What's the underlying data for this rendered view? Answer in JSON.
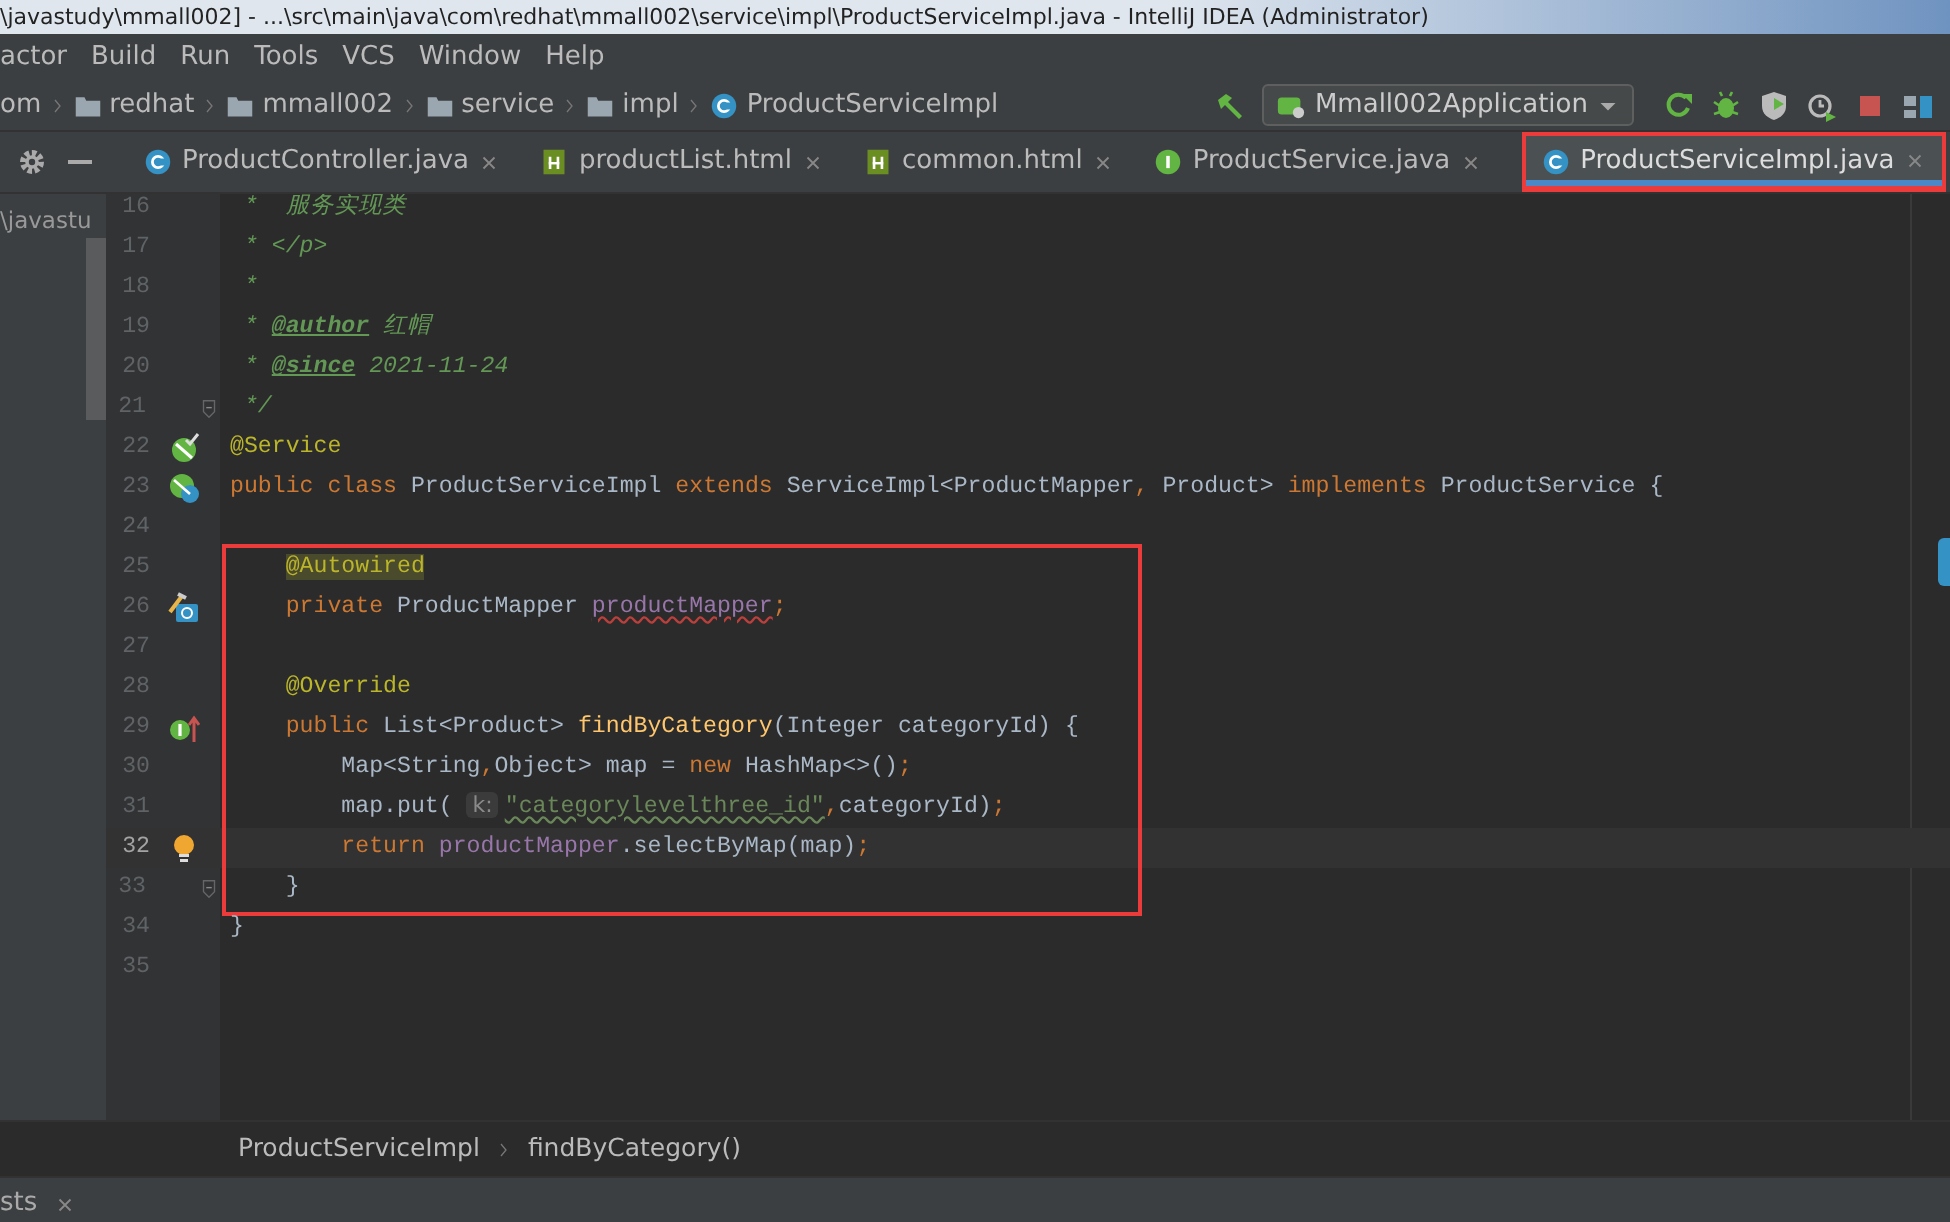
{
  "window": {
    "title": "\\javastudy\\mmall002] - ...\\src\\main\\java\\com\\redhat\\mmall002\\service\\impl\\ProductServiceImpl.java - IntelliJ IDEA (Administrator)"
  },
  "menu": [
    "actor",
    "Build",
    "Run",
    "Tools",
    "VCS",
    "Window",
    "Help"
  ],
  "breadcrumbs": [
    {
      "kind": "text",
      "label": "om"
    },
    {
      "kind": "folder",
      "label": "redhat"
    },
    {
      "kind": "folder",
      "label": "mmall002"
    },
    {
      "kind": "folder",
      "label": "service"
    },
    {
      "kind": "folder",
      "label": "impl"
    },
    {
      "kind": "class",
      "label": "ProductServiceImpl"
    }
  ],
  "run_config": "Mmall002Application",
  "project_panel": {
    "path": "\\javastu"
  },
  "tabs": [
    {
      "label": "ProductController.java",
      "kind": "class",
      "selected": false,
      "highlighted": false
    },
    {
      "label": "productList.html",
      "kind": "html",
      "selected": false,
      "highlighted": false
    },
    {
      "label": "common.html",
      "kind": "html",
      "selected": false,
      "highlighted": false
    },
    {
      "label": "ProductService.java",
      "kind": "interface",
      "selected": false,
      "highlighted": false
    },
    {
      "label": "ProductServiceImpl.java",
      "kind": "class",
      "selected": true,
      "highlighted": true
    }
  ],
  "code": [
    {
      "highlighted": false,
      "lines": [
        {
          "number": "16",
          "current": false,
          "tokens": [
            {
              "kind": "comment",
              "text": " *  服务实现类"
            }
          ]
        },
        {
          "number": "17",
          "current": false,
          "tokens": [
            {
              "kind": "comment",
              "text": " * </p>"
            }
          ]
        },
        {
          "number": "18",
          "current": false,
          "tokens": [
            {
              "kind": "comment",
              "text": " *"
            }
          ]
        },
        {
          "number": "19",
          "current": false,
          "tokens": [
            {
              "kind": "comment",
              "text": " * "
            },
            {
              "kind": "doctag",
              "text": "@author"
            },
            {
              "kind": "comment",
              "text": " 红帽"
            }
          ]
        },
        {
          "number": "20",
          "current": false,
          "tokens": [
            {
              "kind": "comment",
              "text": " * "
            },
            {
              "kind": "doctag",
              "text": "@since"
            },
            {
              "kind": "comment",
              "text": " 2021-11-24"
            }
          ]
        },
        {
          "number": "21",
          "current": false,
          "gutter": {
            "kind": "fold"
          },
          "tokens": [
            {
              "kind": "comment",
              "text": " */"
            }
          ]
        },
        {
          "number": "22",
          "current": false,
          "gutter": {
            "kind": "bean"
          },
          "tokens": [
            {
              "kind": "annotation",
              "text": "@Service"
            }
          ]
        },
        {
          "number": "23",
          "current": false,
          "gutter": {
            "kind": "bean-class"
          },
          "tokens": [
            {
              "kind": "keyword",
              "text": "public class "
            },
            {
              "kind": "plain",
              "text": "ProductServiceImpl "
            },
            {
              "kind": "keyword",
              "text": "extends "
            },
            {
              "kind": "plain",
              "text": "ServiceImpl<ProductMapper"
            },
            {
              "kind": "keyword",
              "text": ","
            },
            {
              "kind": "plain",
              "text": " Product> "
            },
            {
              "kind": "keyword",
              "text": "implements "
            },
            {
              "kind": "plain",
              "text": "ProductService {"
            }
          ]
        },
        {
          "number": "24",
          "current": false
        }
      ]
    },
    {
      "highlighted": true,
      "lines": [
        {
          "number": "25",
          "current": false,
          "tokens": [
            {
              "kind": "annotation-marked",
              "text": "    @Autowired"
            }
          ]
        },
        {
          "number": "26",
          "current": false,
          "gutter": {
            "kind": "autowired"
          },
          "tokens": [
            {
              "kind": "keyword",
              "text": "    private "
            },
            {
              "kind": "plain",
              "text": "ProductMapper "
            },
            {
              "kind": "field-warning",
              "text": "productMapper"
            },
            {
              "kind": "keyword",
              "text": ";"
            }
          ]
        },
        {
          "number": "27",
          "current": false
        },
        {
          "number": "28",
          "current": false,
          "tokens": [
            {
              "kind": "annotation",
              "text": "    @Override"
            }
          ]
        },
        {
          "number": "29",
          "current": false,
          "gutter": {
            "kind": "implements"
          },
          "tokens": [
            {
              "kind": "keyword",
              "text": "    public "
            },
            {
              "kind": "plain",
              "text": "List<Product> "
            },
            {
              "kind": "method",
              "text": "findByCategory"
            },
            {
              "kind": "plain",
              "text": "(Integer categoryId) {"
            }
          ]
        },
        {
          "number": "30",
          "current": false,
          "tokens": [
            {
              "kind": "plain",
              "text": "        Map<String"
            },
            {
              "kind": "keyword",
              "text": ","
            },
            {
              "kind": "plain",
              "text": "Object> map = "
            },
            {
              "kind": "keyword",
              "text": "new "
            },
            {
              "kind": "plain",
              "text": "HashMap<>()"
            },
            {
              "kind": "keyword",
              "text": ";"
            }
          ]
        },
        {
          "number": "31",
          "current": false,
          "tokens": [
            {
              "kind": "plain",
              "text": "        map.put( "
            },
            {
              "kind": "hint",
              "text": "k:"
            },
            {
              "kind": "string-warning",
              "text": "\"categorylevelthree_id\""
            },
            {
              "kind": "keyword",
              "text": ","
            },
            {
              "kind": "plain",
              "text": "categoryId)"
            },
            {
              "kind": "keyword",
              "text": ";"
            }
          ]
        },
        {
          "number": "32",
          "current": true,
          "gutter": {
            "kind": "bulb"
          },
          "tokens": [
            {
              "kind": "keyword",
              "text": "        return "
            },
            {
              "kind": "field",
              "text": "productMapper"
            },
            {
              "kind": "plain",
              "text": ".selectByMap(map)"
            },
            {
              "kind": "keyword",
              "text": ";"
            }
          ]
        },
        {
          "number": "33",
          "current": false,
          "gutter": {
            "kind": "fold"
          },
          "tokens": [
            {
              "kind": "plain",
              "text": "    }"
            }
          ]
        }
      ]
    },
    {
      "highlighted": false,
      "lines": [
        {
          "number": "34",
          "current": false,
          "tokens": [
            {
              "kind": "plain",
              "text": "}"
            }
          ]
        },
        {
          "number": "35",
          "current": false
        }
      ]
    }
  ],
  "editor_breadcrumbs": [
    "ProductServiceImpl",
    "findByCategory()"
  ],
  "bottom_tab": {
    "label": "sts"
  }
}
